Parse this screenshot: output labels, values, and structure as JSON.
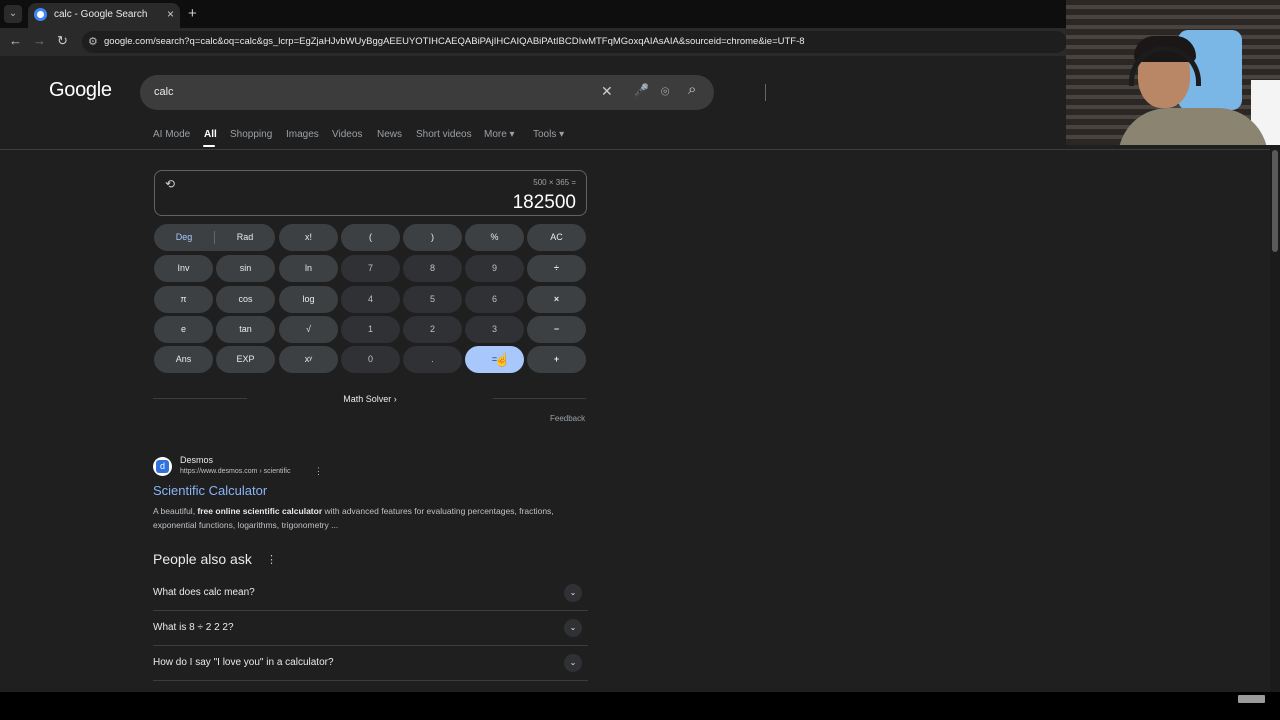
{
  "browser": {
    "tab_title": "calc - Google Search",
    "tab_close": "×",
    "tab_menu": "⌄",
    "new_tab": "+",
    "back": "←",
    "forward": "→",
    "reload": "↻",
    "url": "google.com/search?q=calc&oq=calc&gs_lcrp=EgZjaHJvbWUyBggAEEUYOTIHCAEQABiPAjIHCAIQABiPAtIBCDIwMTFqMGoxqAIAsAIA&sourceid=chrome&ie=UTF-8"
  },
  "google": {
    "logo": "Google",
    "query": "calc",
    "icons": {
      "clear": "✕",
      "mic": "🎤",
      "lens": "⌾",
      "search": "⌕"
    },
    "nav_tabs": [
      {
        "label": "AI Mode"
      },
      {
        "label": "All"
      },
      {
        "label": "Shopping"
      },
      {
        "label": "Images"
      },
      {
        "label": "Videos"
      },
      {
        "label": "News"
      },
      {
        "label": "Short videos"
      },
      {
        "label": "More ▾"
      },
      {
        "label": "Tools ▾"
      }
    ],
    "active_tab": "All"
  },
  "calculator": {
    "history_icon": "⟲",
    "expression": "500 × 365 =",
    "result": "182500",
    "deg": "Deg",
    "rad": "Rad",
    "buttons": {
      "fact": "x!",
      "lparen": "(",
      "rparen": ")",
      "percent": "%",
      "ac": "AC",
      "inv": "Inv",
      "sin": "sin",
      "ln": "ln",
      "seven": "7",
      "eight": "8",
      "nine": "9",
      "divide": "÷",
      "pi": "π",
      "cos": "cos",
      "log": "log",
      "four": "4",
      "five": "5",
      "six": "6",
      "multiply": "×",
      "e": "e",
      "tan": "tan",
      "sqrt": "√",
      "one": "1",
      "two": "2",
      "three": "3",
      "minus": "−",
      "ans": "Ans",
      "exp": "EXP",
      "pow": "xʸ",
      "zero": "0",
      "dot": ".",
      "equals": "=",
      "plus": "+"
    },
    "math_solver": "Math Solver  ›",
    "feedback": "Feedback"
  },
  "result": {
    "favicon_letter": "d",
    "site": "Desmos",
    "url": "https://www.desmos.com › scientific",
    "more": "⋮",
    "title": "Scientific Calculator",
    "snippet_pre": "A beautiful, ",
    "snippet_bold": "free online scientific calculator",
    "snippet_post": " with advanced features for evaluating percentages, fractions, exponential functions, logarithms, trigonometry ..."
  },
  "paa": {
    "title": "People also ask",
    "more": "⋮",
    "chevron": "⌄",
    "questions": [
      "What does calc mean?",
      "What is 8 ÷ 2 2 2?",
      "How do I say \"I love you\" in a calculator?"
    ]
  }
}
